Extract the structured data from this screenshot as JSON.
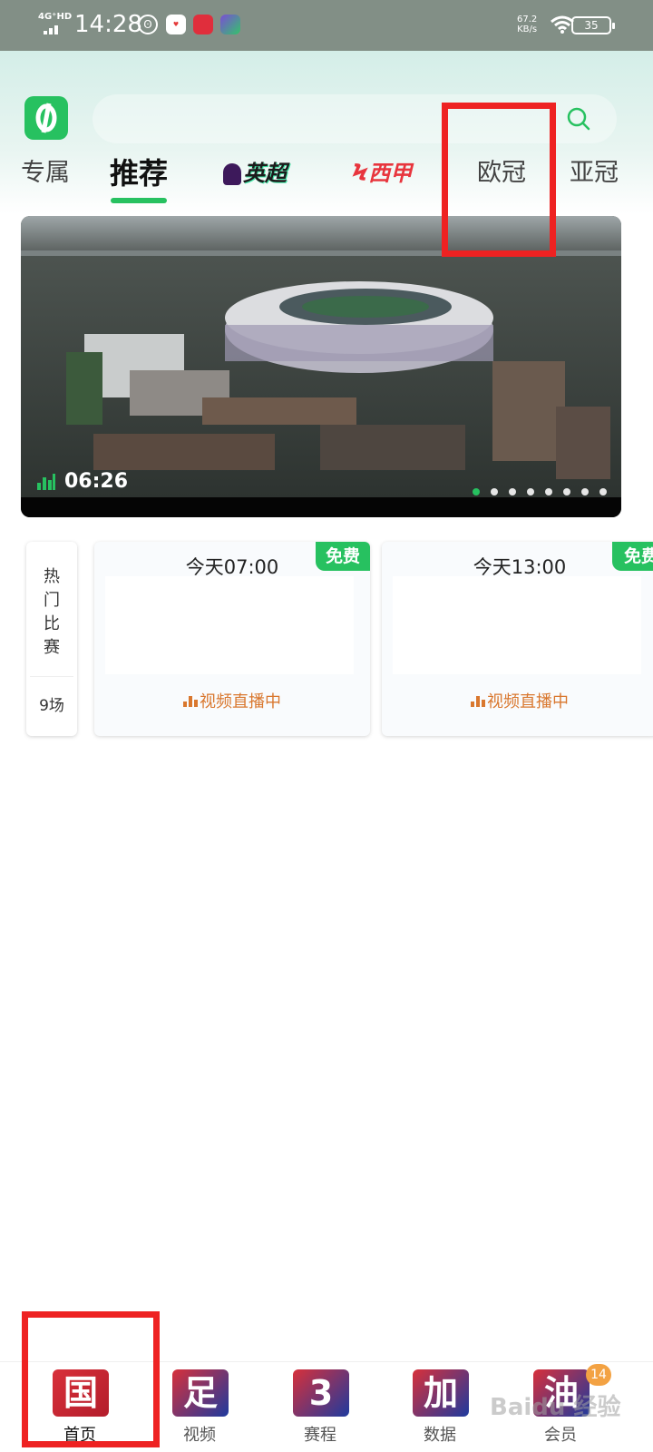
{
  "status_bar": {
    "network": "4G⁺HD",
    "time": "14:28",
    "speed_value": "67.2",
    "speed_unit": "KB/s",
    "battery": "35",
    "app_icons": [
      "game-icon",
      "pinduoduo-icon",
      "iqiyi-icon"
    ]
  },
  "tabs": [
    {
      "label": "专属",
      "active": false
    },
    {
      "label": "推荐",
      "active": true
    },
    {
      "label": "英超",
      "active": false
    },
    {
      "label": "西甲",
      "active": false
    },
    {
      "label": "欧冠",
      "active": false
    },
    {
      "label": "亚冠",
      "active": false
    }
  ],
  "banner": {
    "duration": "06:26",
    "slide_count": 8,
    "active_slide": 1
  },
  "hot_matches": {
    "title_chars": [
      "热",
      "门",
      "比",
      "赛"
    ],
    "count": "9场"
  },
  "matches": [
    {
      "time": "今天07:00",
      "badge": "免费",
      "status": "视频直播中"
    },
    {
      "time": "今天13:00",
      "badge": "免费",
      "status": "视频直播中"
    }
  ],
  "bottom_nav": [
    {
      "glyph": "国",
      "label": "首页",
      "active": true
    },
    {
      "glyph": "足",
      "label": "视频",
      "active": false
    },
    {
      "glyph": "3",
      "label": "赛程",
      "active": false
    },
    {
      "glyph": "加",
      "label": "数据",
      "active": false
    },
    {
      "glyph": "油",
      "label": "会员",
      "active": false,
      "badge": "14"
    }
  ],
  "colors": {
    "brand_green": "#27c160",
    "live_orange": "#d9772e",
    "highlight_red": "#ee2222",
    "premier_league_purple": "#3d195b",
    "laliga_red": "#e8353d"
  },
  "watermark": "Baidu 经验"
}
